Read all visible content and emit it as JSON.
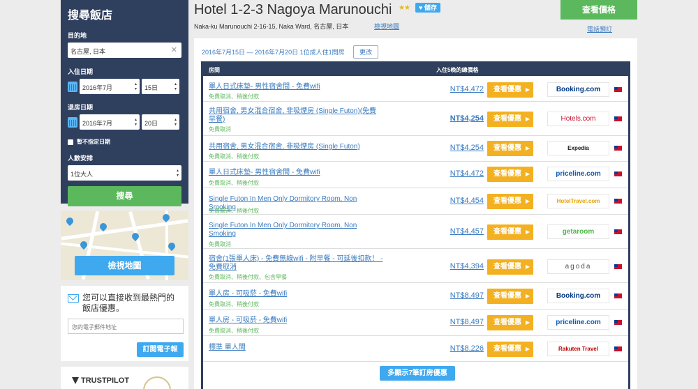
{
  "sidebar": {
    "title": "搜尋飯店",
    "destination_label": "目的地",
    "destination_value": "名古屋, 日本",
    "checkin_label": "入住日期",
    "checkin_month": "2016年7月",
    "checkin_day": "15日",
    "checkout_label": "退房日期",
    "checkout_month": "2016年7月",
    "checkout_day": "20日",
    "no_date_label": "暫不指定日期",
    "guests_label": "人數安排",
    "guests_value": "1位大人",
    "search_button": "搜尋",
    "map_button": "檢視地圖",
    "email_heading": "您可以直接收到最熱門的飯店優惠。",
    "email_placeholder": "您的電子郵件地址",
    "subscribe_button": "訂閱電子報",
    "trustpilot": "TRUSTPILOT"
  },
  "header": {
    "hotel_name": "Hotel 1-2-3 Nagoya Marunouchi",
    "stars": "★★",
    "save_label": "♥ 儲存",
    "address": "Naka-ku Marunouchi 2-16-15, Naka Ward, 名古屋, 日本",
    "map_link": "檢視地圖",
    "view_price_button": "查看價格",
    "phone_link": "電話預訂"
  },
  "main": {
    "date_info": "2016年7月15日 — 2016年7月20日 1位成人住1間房",
    "change_button": "更改",
    "col_room": "房間",
    "col_price": "入住5晚的總價格",
    "deal_label": "查看優惠",
    "more_button": "多顯示7筆訂房優惠",
    "rows": [
      {
        "room": "單人日式床墊- 男性宿舍間 - 免費wifi",
        "perks": "免費取消、稍後付款",
        "price": "NT$4,472",
        "provider": "Booking.com"
      },
      {
        "room": "共用宿舍, 男女混合宿舍, 非吸煙房 (Single Futon)(免費早餐)",
        "perks": "免費取消",
        "price": "NT$4,254",
        "provider": "Hotels.com"
      },
      {
        "room": "共用宿舍, 男女混合宿舍, 非吸煙房 (Single Futon)",
        "perks": "免費取消、稍後付款",
        "price": "NT$4,254",
        "provider": "Expedia"
      },
      {
        "room": "單人日式床墊- 男性宿舍間 - 免費wifi",
        "perks": "免費取消、稍後付款",
        "price": "NT$4,472",
        "provider": "priceline.com"
      },
      {
        "room": "Single Futon In Men Only Dormitory Room, Non Smoking",
        "perks": "免費取消、稍後付款",
        "price": "NT$4,454",
        "provider": "HotelTravel.com"
      },
      {
        "room": "Single Futon In Men Only Dormitory Room, Non Smoking",
        "perks": "免費取消",
        "price": "NT$4,457",
        "provider": "getaroom"
      },
      {
        "room": "宿舍(1張單人床) - 免費無線wifi - 附早餐 - 可延後扣款！ - 免費取消",
        "perks": "免費取消、稍後付款、包含早餐",
        "price": "NT$4,394",
        "provider": "agoda"
      },
      {
        "room": "單人房 - 可吸菸 - 免費wifi",
        "perks": "免費取消、稍後付款",
        "price": "NT$8,497",
        "provider": "Booking.com"
      },
      {
        "room": "單人房 - 可吸菸 - 免費wifi",
        "perks": "免費取消、稍後付款",
        "price": "NT$8,497",
        "provider": "priceline.com"
      },
      {
        "room": "標準 單人間",
        "perks": "",
        "price": "NT$8,226",
        "provider": "Rakuten Travel"
      }
    ]
  },
  "colors": {
    "navy": "#2f3f5e",
    "green": "#5cb85c",
    "blue": "#3fa9ef",
    "orange": "#f3b121"
  }
}
